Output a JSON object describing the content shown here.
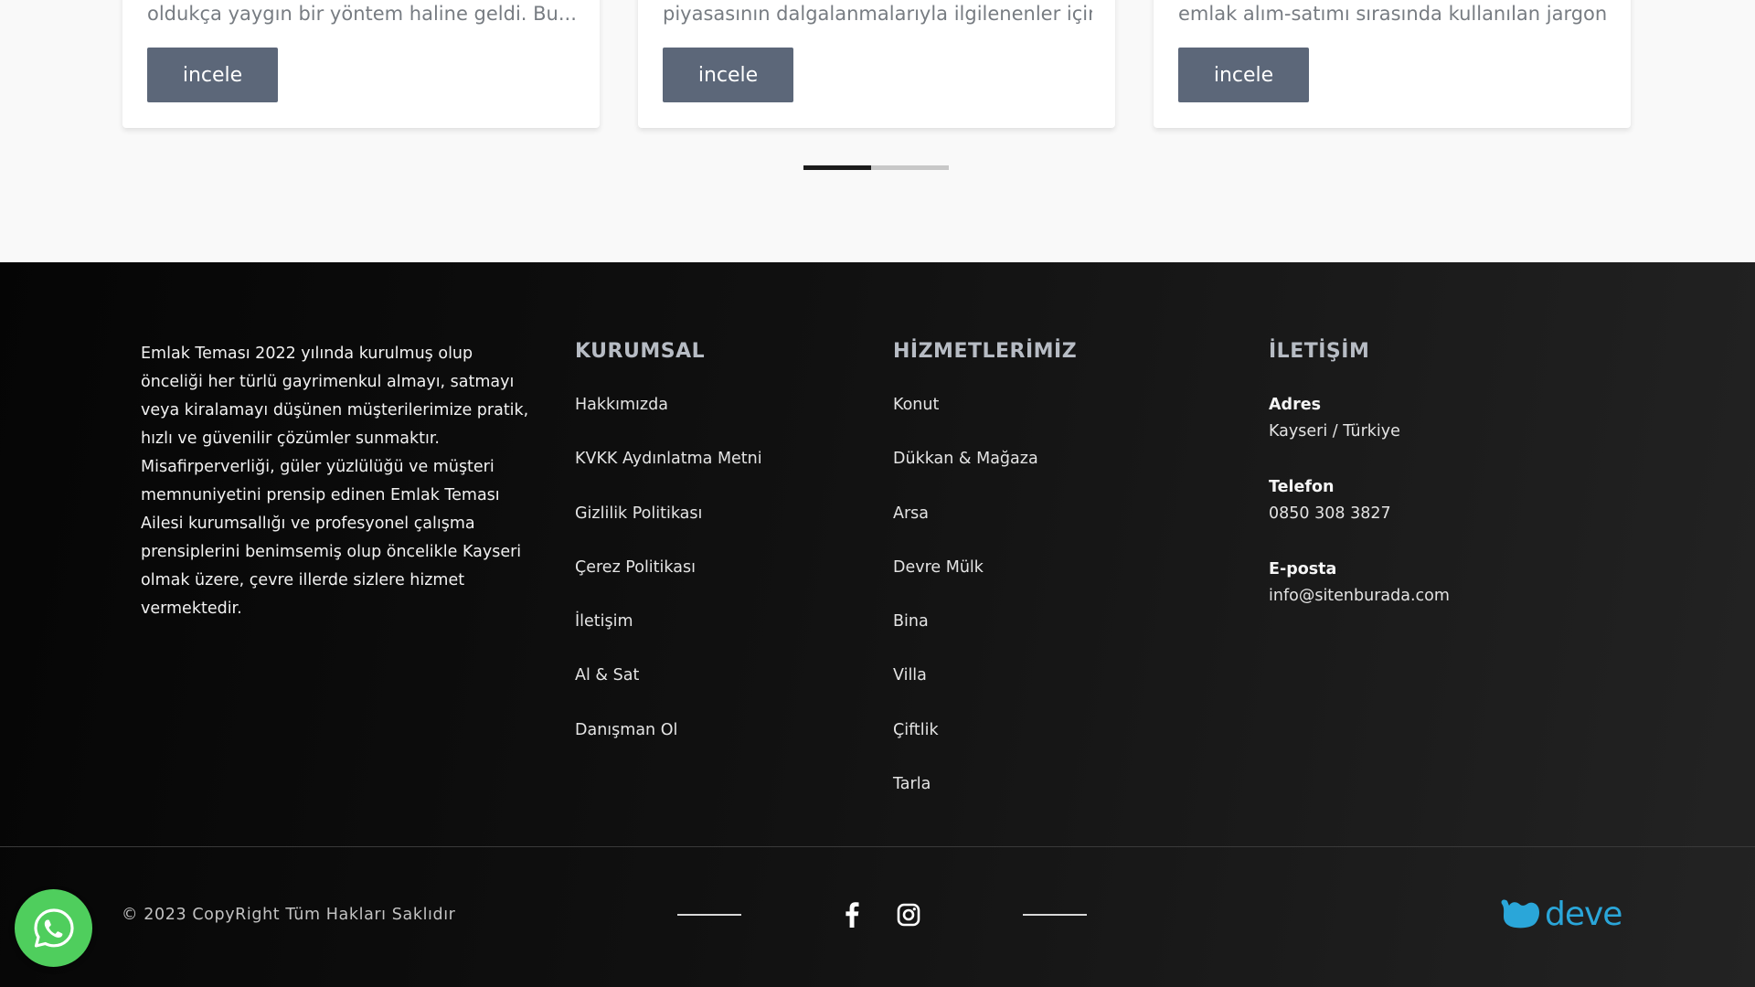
{
  "cards": [
    {
      "excerpt": "oldukça yaygın bir yöntem haline geldi. Bu...",
      "button_label": "incele"
    },
    {
      "excerpt": "piyasasının dalgalanmalarıyla ilgilenenler için...",
      "button_label": "incele"
    },
    {
      "excerpt": "emlak alım-satımı sırasında kullanılan jargon...",
      "button_label": "incele"
    }
  ],
  "pager": {
    "current": 1,
    "total": 2
  },
  "footer": {
    "about": "Emlak Teması 2022 yılında kurulmuş olup önceliği her türlü gayrimenkul almayı, satmayı veya kiralamayı düşünen müşterilerimize pratik, hızlı ve güvenilir çözümler sunmaktır. Misafirperverliği, güler yüzlülüğü ve müşteri memnuniyetini prensip edinen Emlak Teması Ailesi kurumsallığı ve profesyonel çalışma prensiplerini benimsemiş olup öncelikle Kayseri olmak üzere, çevre illerde sizlere hizmet vermektedir.",
    "kurumsal": {
      "title": "KURUMSAL",
      "items": [
        "Hakkımızda",
        "KVKK Aydınlatma Metni",
        "Gizlilik Politikası",
        "Çerez Politikası",
        "İletişim",
        "Al & Sat",
        "Danışman Ol"
      ]
    },
    "hizmetler": {
      "title": "HİZMETLERİMİZ",
      "items": [
        "Konut",
        "Dükkan & Mağaza",
        "Arsa",
        "Devre Mülk",
        "Bina",
        "Villa",
        "Çiftlik",
        "Tarla"
      ]
    },
    "iletisim": {
      "title": "İLETİŞİM",
      "address_label": "Adres",
      "address": "Kayseri / Türkiye",
      "phone_label": "Telefon",
      "phone": "0850 308 3827",
      "email_label": "E-posta",
      "email": "info@sitenburada.com"
    },
    "copyright": "© 2023 CopyRight Tüm Hakları Saklıdır",
    "social": [
      "facebook-icon",
      "instagram-icon"
    ],
    "brand": "deve"
  },
  "colors": {
    "button": "#5c6779",
    "brand": "#2aa6d9",
    "whatsapp": "#4fce5d"
  },
  "floating": {
    "icon": "whatsapp-icon"
  }
}
